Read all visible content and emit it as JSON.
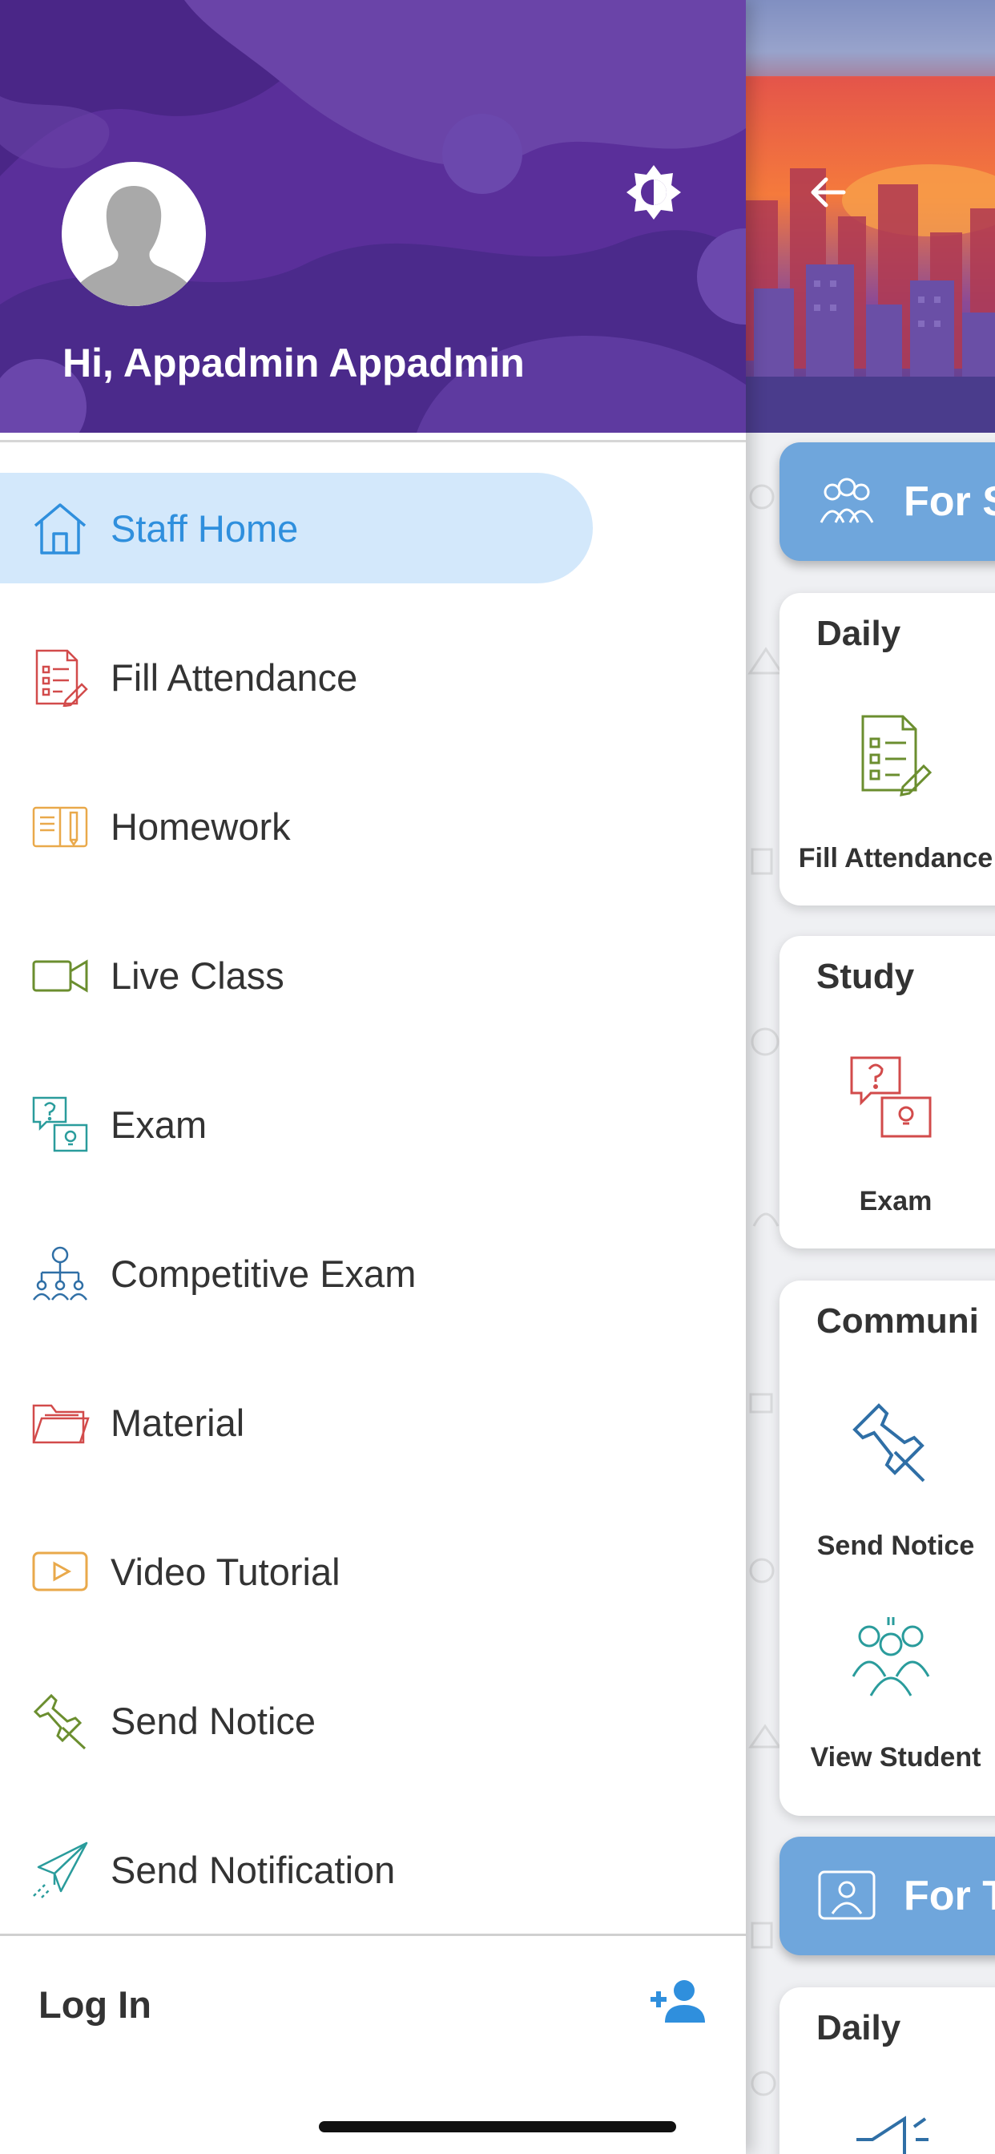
{
  "drawer": {
    "greeting": "Hi, Appadmin Appadmin",
    "menu_items": [
      {
        "label": "Staff Home",
        "icon": "home-icon",
        "active": true
      },
      {
        "label": "Fill Attendance",
        "icon": "attendance-icon"
      },
      {
        "label": "Homework",
        "icon": "homework-book-icon"
      },
      {
        "label": "Live Class",
        "icon": "video-camera-icon"
      },
      {
        "label": "Exam",
        "icon": "exam-question-icon"
      },
      {
        "label": "Competitive Exam",
        "icon": "competitive-exam-icon"
      },
      {
        "label": "Material",
        "icon": "folder-icon"
      },
      {
        "label": "Video Tutorial",
        "icon": "play-video-icon"
      },
      {
        "label": "Send Notice",
        "icon": "pin-icon"
      },
      {
        "label": "Send Notification",
        "icon": "paper-plane-icon"
      }
    ],
    "footer": {
      "login_label": "Log In",
      "icon": "add-user-icon"
    }
  },
  "background_app": {
    "section_bands": [
      {
        "label": "For S"
      },
      {
        "label": "For T"
      }
    ],
    "cards": [
      {
        "title": "Daily",
        "tiles": [
          {
            "label": "Fill Attendance",
            "icon": "attendance-icon"
          }
        ]
      },
      {
        "title": "Study",
        "tiles": [
          {
            "label": "Exam",
            "icon": "exam-question-icon"
          }
        ]
      },
      {
        "title": "Communi",
        "tiles": [
          {
            "label": "Send Notice",
            "icon": "pin-icon"
          },
          {
            "label": "View Student",
            "icon": "students-group-icon"
          }
        ]
      },
      {
        "title": "Daily",
        "tiles": []
      }
    ]
  },
  "colors": {
    "header_purple": "#5a2f9a",
    "active_item_bg": "#d3e8fb",
    "active_item_text": "#2f8fdd",
    "section_band": "#6fa6dc"
  }
}
